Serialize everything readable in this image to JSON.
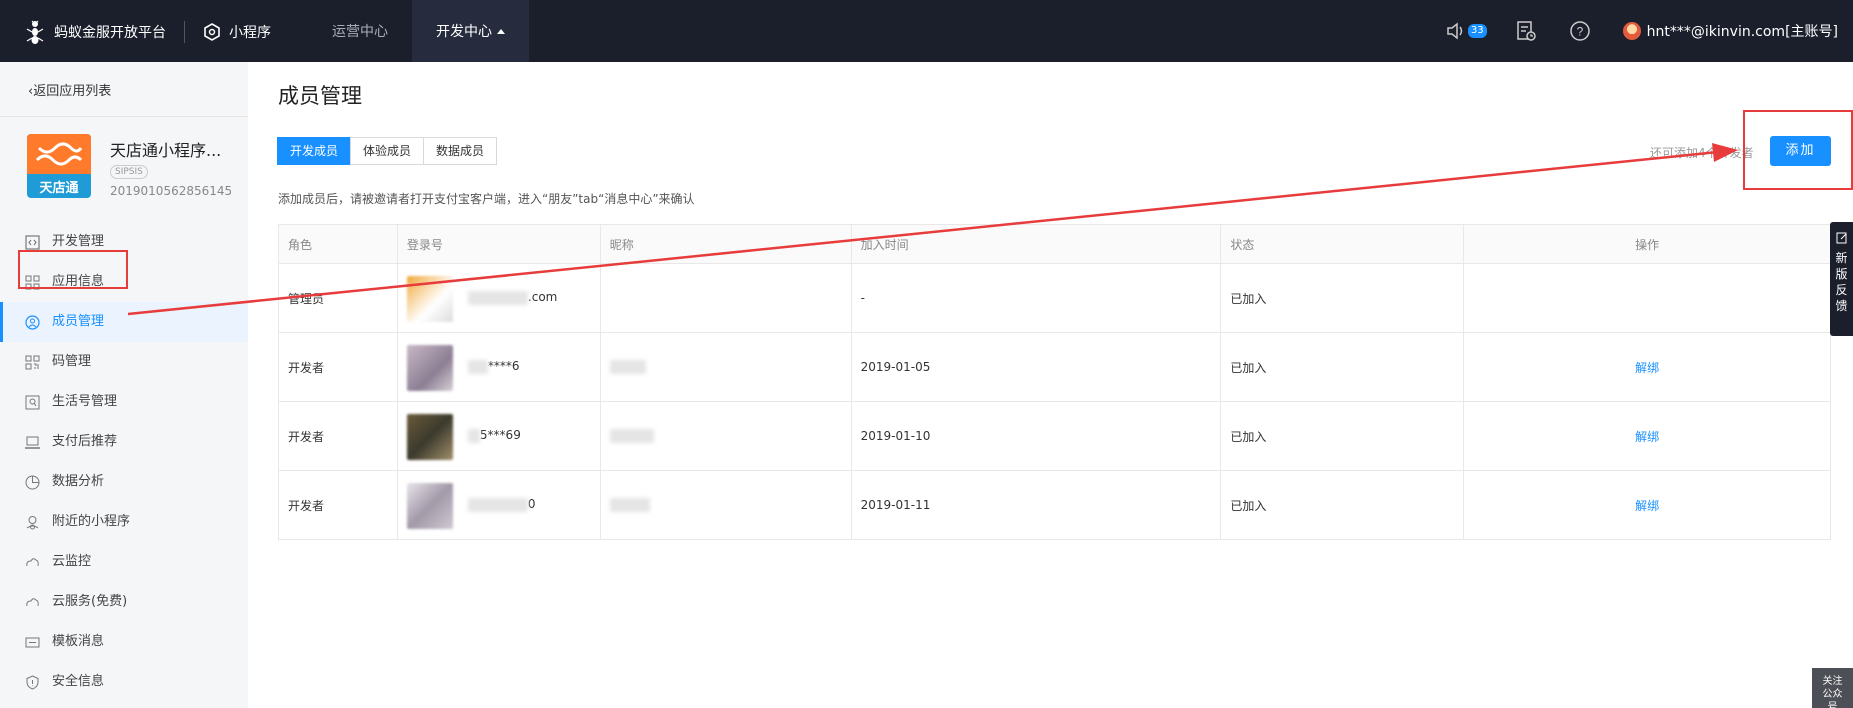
{
  "header": {
    "brand": "蚂蚁金服开放平台",
    "product": "小程序",
    "nav": [
      {
        "label": "运营中心"
      },
      {
        "label": "开发中心"
      }
    ],
    "notification_count": "33",
    "user": "hnt***@ikinvin.com[主账号]"
  },
  "sidebar": {
    "back_link": "返回应用列表",
    "app": {
      "logo_text": "天店通",
      "name": "天店通小程序...",
      "tag": "SIPSIS",
      "id": "2019010562856145"
    },
    "items": [
      {
        "label": "开发管理",
        "icon": "code-icon"
      },
      {
        "label": "应用信息",
        "icon": "grid-icon"
      },
      {
        "label": "成员管理",
        "icon": "user-circle-icon"
      },
      {
        "label": "码管理",
        "icon": "qr-code-icon"
      },
      {
        "label": "生活号管理",
        "icon": "life-icon"
      },
      {
        "label": "支付后推荐",
        "icon": "laptop-icon"
      },
      {
        "label": "数据分析",
        "icon": "pie-chart-icon"
      },
      {
        "label": "附近的小程序",
        "icon": "location-icon"
      },
      {
        "label": "云监控",
        "icon": "cloud-icon"
      },
      {
        "label": "云服务(免费)",
        "icon": "cloud-icon"
      },
      {
        "label": "模板消息",
        "icon": "message-icon"
      },
      {
        "label": "安全信息",
        "icon": "shield-icon"
      }
    ]
  },
  "main": {
    "title": "成员管理",
    "tabs": [
      {
        "label": "开发成员"
      },
      {
        "label": "体验成员"
      },
      {
        "label": "数据成员"
      }
    ],
    "hint": "添加成员后，请被邀请者打开支付宝客户端，进入“朋友”tab“消息中心”来确认",
    "right_hint": "还可添加4个开发者",
    "add_button": "添加",
    "table": {
      "columns": [
        "角色",
        "登录号",
        "昵称",
        "加入时间",
        "状态",
        "操作"
      ],
      "rows": [
        {
          "role": "管理员",
          "login": ".com",
          "nickname": "",
          "joined": "-",
          "status": "已加入",
          "action": ""
        },
        {
          "role": "开发者",
          "login": "****6",
          "nickname": "",
          "joined": "2019-01-05",
          "status": "已加入",
          "action": "解绑"
        },
        {
          "role": "开发者",
          "login": "5***69",
          "nickname": "",
          "joined": "2019-01-10",
          "status": "已加入",
          "action": "解绑"
        },
        {
          "role": "开发者",
          "login": "0",
          "nickname": "",
          "joined": "2019-01-11",
          "status": "已加入",
          "action": "解绑"
        }
      ]
    }
  },
  "feedback": "新版反馈",
  "follow": "关注公众号",
  "colors": {
    "accent": "#1890ff",
    "annotation": "#e83c3c",
    "topbar": "#1b1f2c"
  }
}
